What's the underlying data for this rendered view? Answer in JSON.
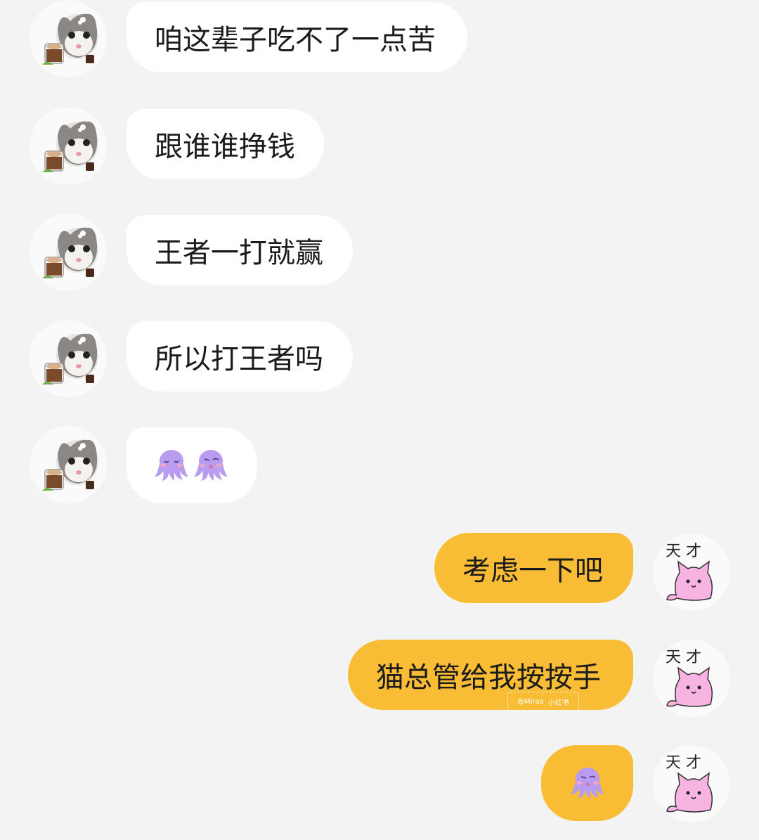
{
  "chat": {
    "messages": [
      {
        "side": "left",
        "sender": "cat",
        "text": "咱这辈子吃不了一点苦"
      },
      {
        "side": "left",
        "sender": "cat",
        "text": "跟谁谁挣钱"
      },
      {
        "side": "left",
        "sender": "cat",
        "text": "王者一打就赢"
      },
      {
        "side": "left",
        "sender": "cat",
        "text": "所以打王者吗"
      },
      {
        "side": "left",
        "sender": "cat",
        "stickers": [
          "octopus-sleepy-icon",
          "octopus-blush-icon"
        ]
      },
      {
        "side": "right",
        "sender": "me",
        "text": "考虑一下吧"
      },
      {
        "side": "right",
        "sender": "me",
        "text": "猫总管给我按按手"
      },
      {
        "side": "right",
        "sender": "me",
        "stickers": [
          "octopus-blush-icon"
        ]
      }
    ]
  },
  "avatars": {
    "cat": {
      "icon": "cat-coffee-avatar-icon"
    },
    "me": {
      "icon": "pink-cat-tiancai-avatar-icon",
      "label": "天 才"
    }
  },
  "watermark": {
    "handle": "@Miraa",
    "brand": "小红书"
  },
  "colors": {
    "background": "#f3f3f3",
    "incoming_bubble": "#ffffff",
    "outgoing_bubble": "#f9bd35",
    "octopus": "#b79cf0",
    "pink_cat": "#f7b4e2"
  }
}
